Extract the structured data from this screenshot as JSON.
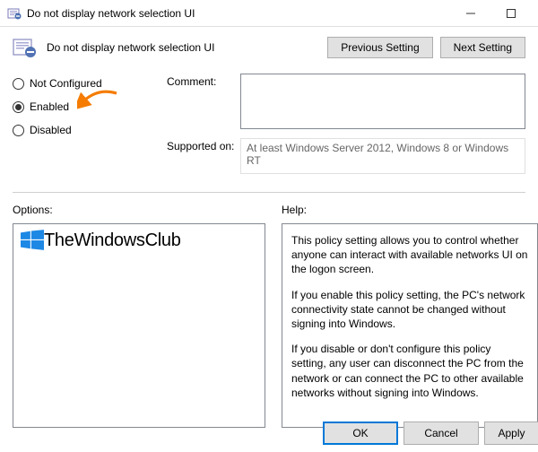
{
  "window": {
    "title": "Do not display network selection UI",
    "heading": "Do not display network selection UI"
  },
  "nav": {
    "previous": "Previous Setting",
    "next": "Next Setting"
  },
  "state": {
    "not_configured": "Not Configured",
    "enabled": "Enabled",
    "disabled": "Disabled",
    "selected": "enabled"
  },
  "labels": {
    "comment": "Comment:",
    "supported_on": "Supported on:",
    "options": "Options:",
    "help": "Help:"
  },
  "supported_on_text": "At least Windows Server 2012, Windows 8 or Windows RT",
  "help_paragraphs": {
    "p1": "This policy setting allows you to control whether anyone can interact with available networks UI on the logon screen.",
    "p2": "If you enable this policy setting, the PC's network connectivity state cannot be changed without signing into Windows.",
    "p3": "If you disable or don't configure this policy setting, any user can disconnect the PC from the network or can connect the PC to other available networks without signing into Windows."
  },
  "watermark": "TheWindowsClub",
  "footer": {
    "ok": "OK",
    "cancel": "Cancel",
    "apply": "Apply"
  }
}
